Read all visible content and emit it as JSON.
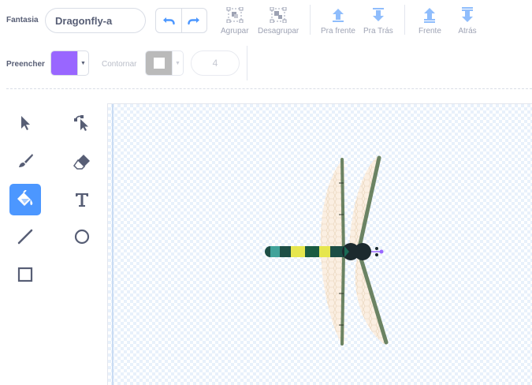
{
  "costume": {
    "label": "Fantasia",
    "name": "Dragonfly-a"
  },
  "toolbar": {
    "group_label": "Agrupar",
    "ungroup_label": "Desagrupar",
    "forward_label": "Pra frente",
    "backward_label": "Pra Trás",
    "front_label": "Frente",
    "back_label": "Atrás"
  },
  "style": {
    "fill_label": "Preencher",
    "fill_color": "#9966ff",
    "outline_label": "Contornar",
    "outline_color": "#b3b3b3",
    "outline_width": "4"
  },
  "tools": [
    {
      "name": "select",
      "icon": "arrow-pointer-icon"
    },
    {
      "name": "reshape",
      "icon": "reshape-icon"
    },
    {
      "name": "brush",
      "icon": "brush-icon"
    },
    {
      "name": "eraser",
      "icon": "eraser-icon"
    },
    {
      "name": "fill",
      "icon": "paint-bucket-icon",
      "active": true
    },
    {
      "name": "text",
      "icon": "text-icon"
    },
    {
      "name": "line",
      "icon": "line-icon"
    },
    {
      "name": "circle",
      "icon": "circle-icon"
    },
    {
      "name": "rectangle",
      "icon": "rectangle-icon"
    }
  ],
  "colors": {
    "accent": "#4c97ff",
    "text": "#575e75",
    "muted": "#9ea3b4"
  }
}
